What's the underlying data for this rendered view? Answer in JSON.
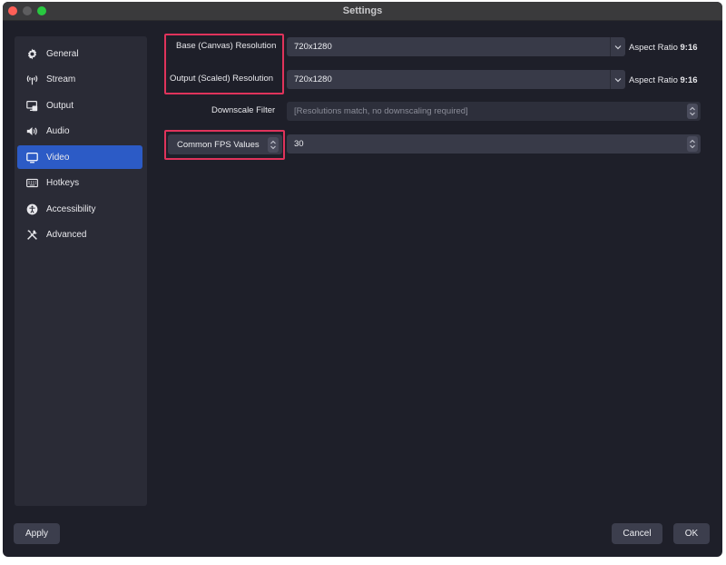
{
  "window": {
    "title": "Settings"
  },
  "sidebar": {
    "items": [
      {
        "label": "General",
        "icon": "gear-icon"
      },
      {
        "label": "Stream",
        "icon": "antenna-icon"
      },
      {
        "label": "Output",
        "icon": "output-icon"
      },
      {
        "label": "Audio",
        "icon": "speaker-icon"
      },
      {
        "label": "Video",
        "icon": "monitor-icon",
        "active": true
      },
      {
        "label": "Hotkeys",
        "icon": "keyboard-icon"
      },
      {
        "label": "Accessibility",
        "icon": "accessibility-icon"
      },
      {
        "label": "Advanced",
        "icon": "tools-icon"
      }
    ]
  },
  "video": {
    "base_resolution": {
      "label": "Base (Canvas) Resolution",
      "value": "720x1280",
      "aspect_prefix": "Aspect Ratio",
      "aspect_value": "9:16"
    },
    "output_resolution": {
      "label": "Output (Scaled) Resolution",
      "value": "720x1280",
      "aspect_prefix": "Aspect Ratio",
      "aspect_value": "9:16"
    },
    "downscale_filter": {
      "label": "Downscale Filter",
      "value": "[Resolutions match, no downscaling required]"
    },
    "fps": {
      "type_label": "Common FPS Values",
      "value": "30"
    }
  },
  "footer": {
    "apply": "Apply",
    "cancel": "Cancel",
    "ok": "OK"
  },
  "colors": {
    "accent": "#2c5bc6",
    "highlight": "#e0335b",
    "background": "#1e1f29"
  }
}
